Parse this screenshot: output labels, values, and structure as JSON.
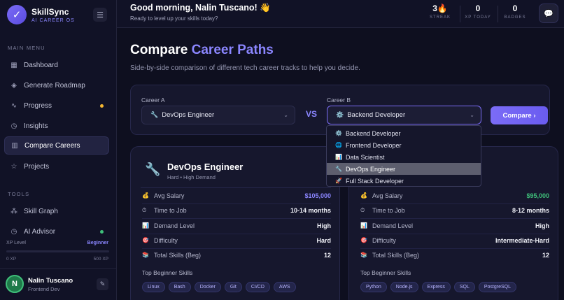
{
  "brand": {
    "name": "SkillSync",
    "sub": "AI CAREER OS",
    "logo_icon": "check-icon",
    "logo_glyph": "✓"
  },
  "sidebar": {
    "main_menu_label": "MAIN MENU",
    "tools_label": "TOOLS",
    "items": [
      {
        "label": "Dashboard",
        "icon": "grid-icon",
        "glyph": "▦"
      },
      {
        "label": "Generate Roadmap",
        "icon": "layers-icon",
        "glyph": "◈"
      },
      {
        "label": "Progress",
        "icon": "activity-icon",
        "glyph": "∿"
      },
      {
        "label": "Insights",
        "icon": "clock-icon",
        "glyph": "◷"
      },
      {
        "label": "Compare Careers",
        "icon": "columns-icon",
        "glyph": "▥"
      },
      {
        "label": "Projects",
        "icon": "star-icon",
        "glyph": "☆"
      },
      {
        "label": "Skill Graph",
        "icon": "network-icon",
        "glyph": "⁂"
      },
      {
        "label": "AI Advisor",
        "icon": "clock-icon",
        "glyph": "◷"
      }
    ],
    "progress_dot_color": "#f5b731",
    "advisor_dot_color": "#3fbf7a",
    "xp_label": "XP Level",
    "xp_level": "Beginner",
    "xp_min": "0 XP",
    "xp_max": "500 XP",
    "xp_progress": 0
  },
  "user": {
    "initial": "N",
    "name": "Nalin Tuscano",
    "role": "Frontend Dev"
  },
  "topbar": {
    "greeting": "Good morning, Nalin Tuscano! 👋",
    "greeting_sub": "Ready to level up your skills today?",
    "streak_value": "3🔥",
    "streak_label": "STREAK",
    "xp_today_value": "0",
    "xp_today_label": "XP TODAY",
    "badges_value": "0",
    "badges_label": "BADGES",
    "chat_icon": "chat-icon"
  },
  "page": {
    "title_a": "Compare ",
    "title_b": "Career Paths",
    "subtitle": "Side-by-side comparison of different tech career tracks to help you decide.",
    "accent": "#8b86ff"
  },
  "selector": {
    "career_a_label": "Career A",
    "career_a_value": "DevOps Engineer",
    "career_a_icon": "🔧",
    "vs": "VS",
    "career_b_label": "Career B",
    "career_b_value": "Backend Developer",
    "career_b_icon": "⚙️",
    "compare_label": "Compare ›"
  },
  "dropdown": [
    {
      "label": "Backend Developer",
      "icon": "⚙️"
    },
    {
      "label": "Frontend Developer",
      "icon": "🌐"
    },
    {
      "label": "Data Scientist",
      "icon": "📊"
    },
    {
      "label": "DevOps Engineer",
      "icon": "🔧"
    },
    {
      "label": "Full Stack Developer",
      "icon": "🚀"
    }
  ],
  "card_a": {
    "icon": "🔧",
    "title": "DevOps Engineer",
    "meta": "Hard • High Demand",
    "metrics": [
      {
        "icon": "💰",
        "label": "Avg Salary",
        "value": "$105,000",
        "color": "#8b86ff"
      },
      {
        "icon": "⏱",
        "label": "Time to Job",
        "value": "10-14 months",
        "color": "#f0f1f8"
      },
      {
        "icon": "📊",
        "label": "Demand Level",
        "value": "High",
        "color": "#f0f1f8"
      },
      {
        "icon": "🎯",
        "label": "Difficulty",
        "value": "Hard",
        "color": "#f0f1f8"
      },
      {
        "icon": "📚",
        "label": "Total Skills (Beg)",
        "value": "12",
        "color": "#f0f1f8"
      }
    ],
    "skills_heading": "Top Beginner Skills",
    "skills": [
      "Linux",
      "Bash",
      "Docker",
      "Git",
      "CI/CD",
      "AWS"
    ]
  },
  "card_b": {
    "metrics": [
      {
        "icon": "💰",
        "label": "Avg Salary",
        "value": "$95,000",
        "color": "#3fbf7a"
      },
      {
        "icon": "⏱",
        "label": "Time to Job",
        "value": "8-12 months",
        "color": "#f0f1f8"
      },
      {
        "icon": "📊",
        "label": "Demand Level",
        "value": "High",
        "color": "#f0f1f8"
      },
      {
        "icon": "🎯",
        "label": "Difficulty",
        "value": "Intermediate-Hard",
        "color": "#f0f1f8"
      },
      {
        "icon": "📚",
        "label": "Total Skills (Beg)",
        "value": "12",
        "color": "#f0f1f8"
      }
    ],
    "skills_heading": "Top Beginner Skills",
    "skills": [
      "Python",
      "Node.js",
      "Express",
      "SQL",
      "PostgreSQL"
    ]
  }
}
